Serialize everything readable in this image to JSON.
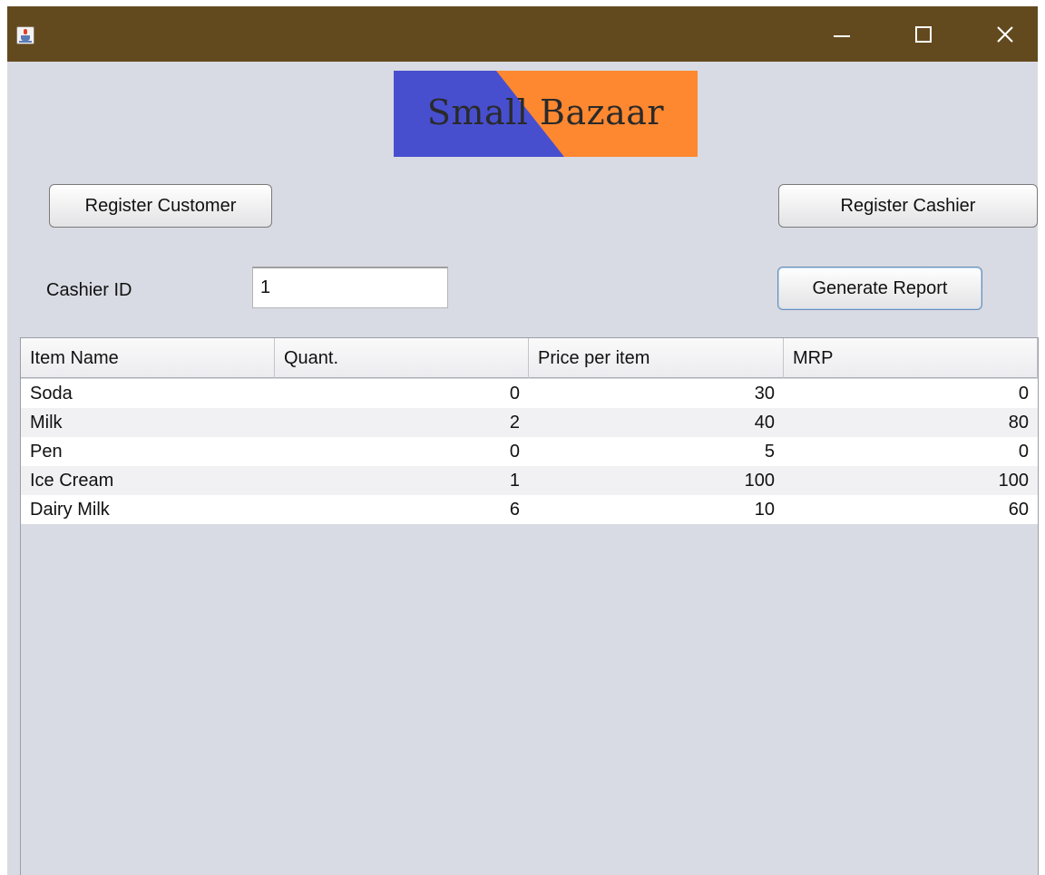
{
  "window": {
    "controls": {
      "minimize_icon": "minimize-icon",
      "maximize_icon": "maximize-icon",
      "close_icon": "close-icon"
    },
    "titlebar_color": "#634a1e"
  },
  "logo": {
    "text": "Small Bazaar",
    "left_color": "#474fcf",
    "right_color": "#fe8830"
  },
  "buttons": {
    "register_customer": "Register Customer",
    "register_cashier": "Register Cashier",
    "generate_report": "Generate Report"
  },
  "cashier": {
    "label": "Cashier ID",
    "value": "1"
  },
  "table": {
    "headers": [
      "Item Name",
      "Quant.",
      "Price per item",
      "MRP"
    ],
    "rows": [
      [
        "Soda",
        "0",
        "30",
        "0"
      ],
      [
        "Milk",
        "2",
        "40",
        "80"
      ],
      [
        "Pen",
        "0",
        "5",
        "0"
      ],
      [
        "Ice Cream",
        "1",
        "100",
        "100"
      ],
      [
        "Dairy Milk",
        "6",
        "10",
        "60"
      ]
    ]
  }
}
